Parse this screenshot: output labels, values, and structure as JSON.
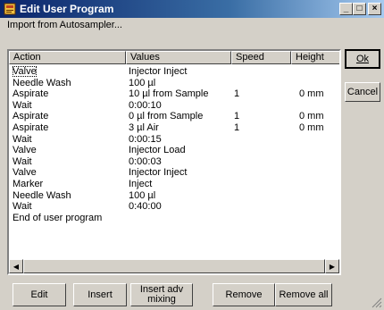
{
  "window": {
    "title": "Edit User Program"
  },
  "menu": {
    "import_label": "Import from Autosampler..."
  },
  "columns": [
    "Action",
    "Values",
    "Speed",
    "Height"
  ],
  "rows": [
    {
      "action": "Valve",
      "values": "Injector Inject",
      "speed": "",
      "height": ""
    },
    {
      "action": "Needle Wash",
      "values": "100 µl",
      "speed": "",
      "height": ""
    },
    {
      "action": "Aspirate",
      "values": "10 µl from Sample",
      "speed": "1",
      "height": "0 mm"
    },
    {
      "action": "Wait",
      "values": "0:00:10",
      "speed": "",
      "height": ""
    },
    {
      "action": "Aspirate",
      "values": "0 µl from Sample",
      "speed": "1",
      "height": "0 mm"
    },
    {
      "action": "Aspirate",
      "values": "3 µl Air",
      "speed": "1",
      "height": "0 mm"
    },
    {
      "action": "Wait",
      "values": "0:00:15",
      "speed": "",
      "height": ""
    },
    {
      "action": "Valve",
      "values": "Injector Load",
      "speed": "",
      "height": ""
    },
    {
      "action": "Wait",
      "values": "0:00:03",
      "speed": "",
      "height": ""
    },
    {
      "action": "Valve",
      "values": "Injector Inject",
      "speed": "",
      "height": ""
    },
    {
      "action": "Marker",
      "values": "Inject",
      "speed": "",
      "height": ""
    },
    {
      "action": "Needle Wash",
      "values": "100 µl",
      "speed": "",
      "height": ""
    },
    {
      "action": "Wait",
      "values": "0:40:00",
      "speed": "",
      "height": ""
    },
    {
      "action": "End of user program",
      "values": "",
      "speed": "",
      "height": ""
    }
  ],
  "buttons": {
    "ok": "Ok",
    "cancel": "Cancel",
    "edit": "Edit",
    "insert": "Insert",
    "insert_adv_line1": "Insert adv",
    "insert_adv_line2": "mixing",
    "remove": "Remove",
    "remove_all": "Remove all"
  },
  "title_buttons": {
    "minimize": "_",
    "maximize": "□",
    "close": "×"
  },
  "icons": {
    "app": "app-window-icon",
    "scroll_left": "arrow-left-icon",
    "scroll_right": "arrow-right-icon"
  },
  "colors": {
    "titlebar_start": "#0a246a",
    "titlebar_end": "#a6caf0",
    "face": "#d4d0c8"
  }
}
